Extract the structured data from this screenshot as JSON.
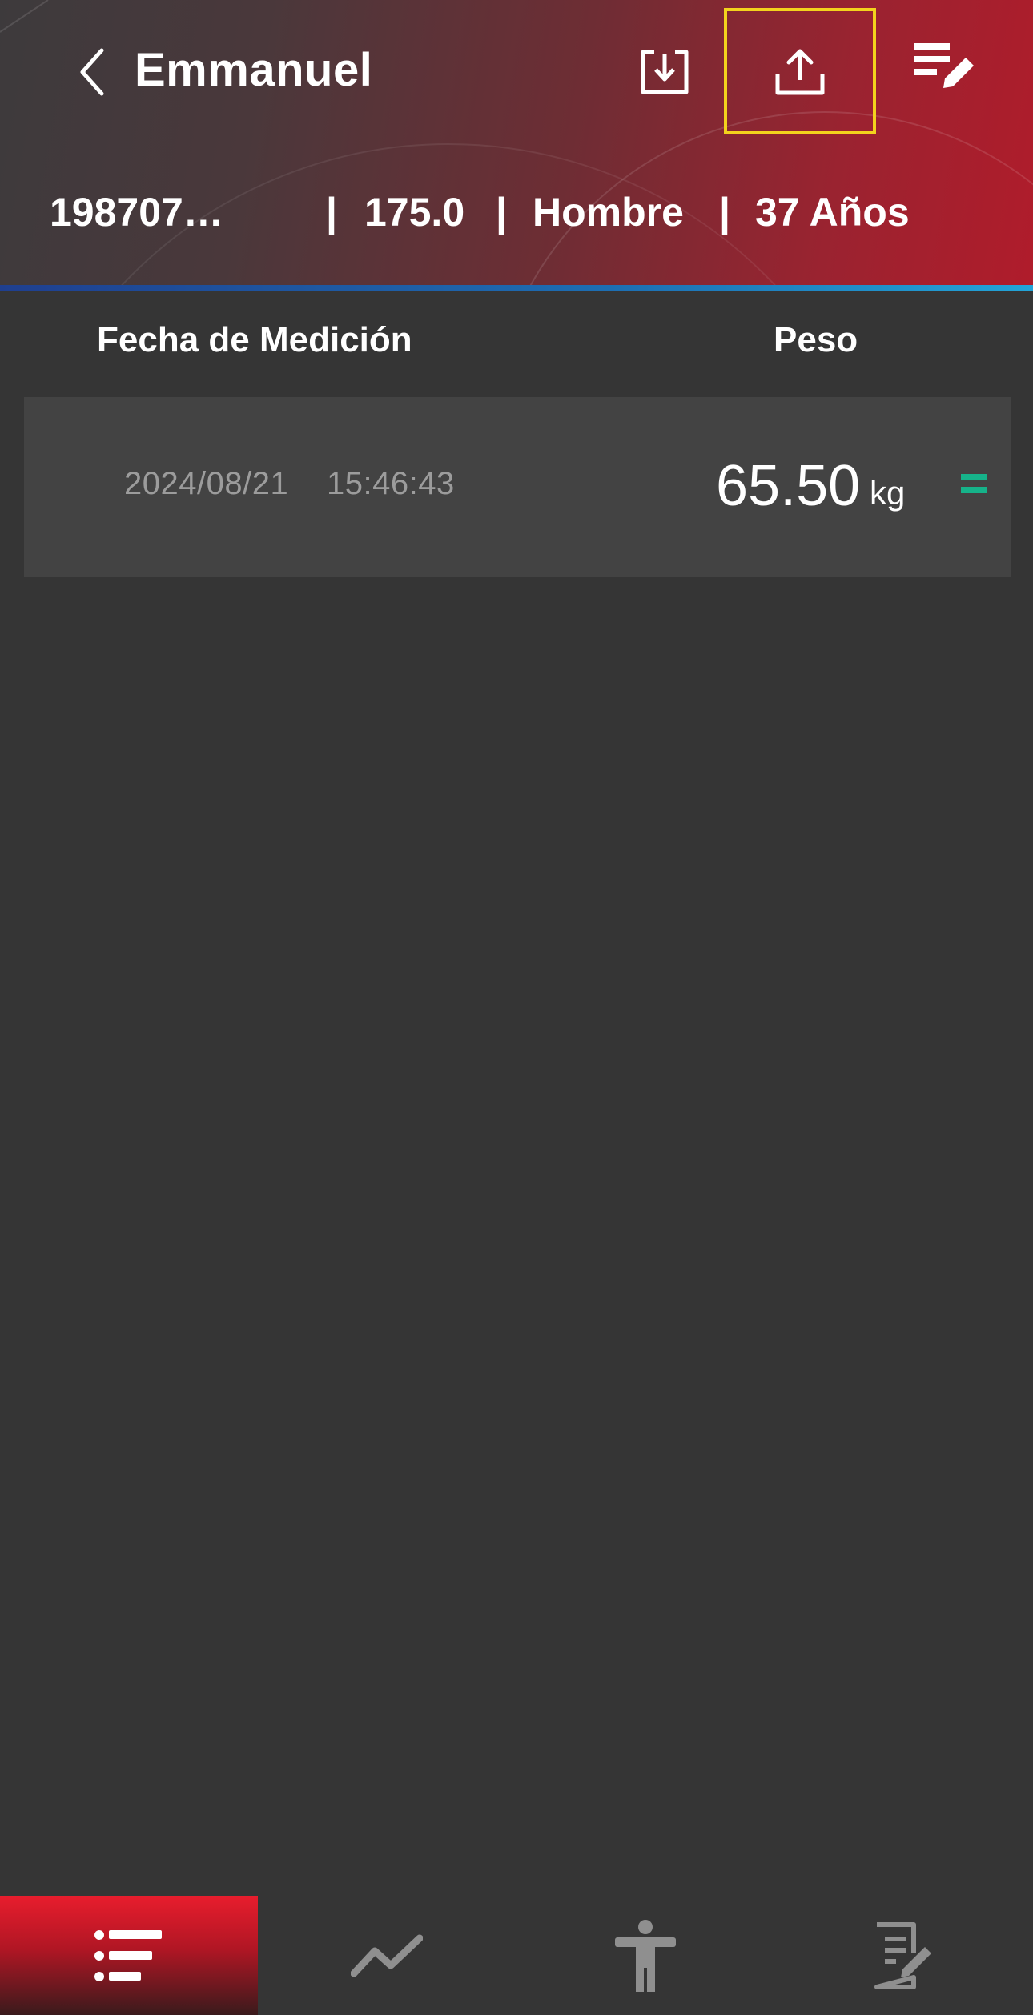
{
  "header": {
    "title": "Emmanuel",
    "back_icon": "chevron-left-icon",
    "actions": [
      {
        "name": "download",
        "icon": "download-icon"
      },
      {
        "name": "upload",
        "icon": "upload-icon",
        "highlighted": true
      },
      {
        "name": "edit",
        "icon": "edit-list-icon"
      }
    ],
    "colors": {
      "gradient_start": "#3d3a3c",
      "gradient_end": "#b01c2b",
      "highlight": "#f3d31d"
    }
  },
  "profile": {
    "id": "198707…",
    "sep1": "|",
    "height": "175.0",
    "sep2": "|",
    "gender": "Hombre",
    "sep3": "|",
    "age": "37 Años"
  },
  "table": {
    "headers": {
      "date": "Fecha de Medición",
      "weight": "Peso"
    },
    "rows": [
      {
        "date": "2024/08/21",
        "time": "15:46:43",
        "weight": "65.50",
        "unit": "kg",
        "trend": "equal",
        "trend_color": "#16b38a"
      }
    ]
  },
  "bottom_nav": {
    "items": [
      {
        "name": "history",
        "icon": "list-icon",
        "active": true
      },
      {
        "name": "trend",
        "icon": "trend-chart-icon",
        "active": false
      },
      {
        "name": "body",
        "icon": "person-icon",
        "active": false
      },
      {
        "name": "report",
        "icon": "report-edit-icon",
        "active": false
      }
    ]
  }
}
